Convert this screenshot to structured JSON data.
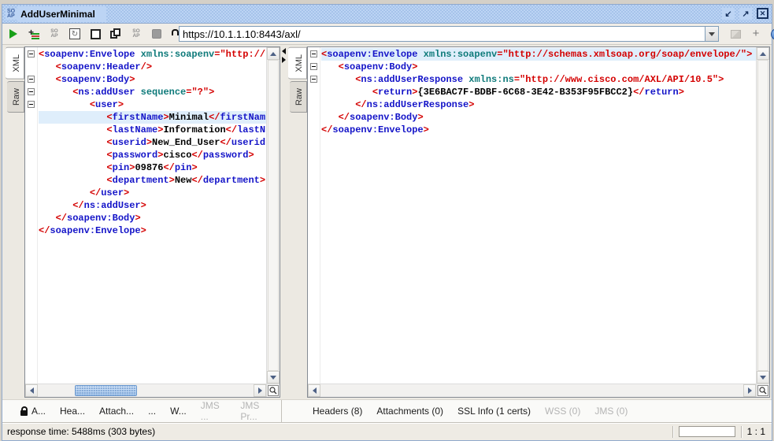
{
  "colors": {
    "tag": "#1414c8",
    "delim": "#d40000",
    "attr": "#0e7a7a",
    "value": "#d40000",
    "text": "#000000",
    "line_highlight": "#dfeefb",
    "titlebar_base": "#bcd4f4",
    "titlebar_checker": "#a6c3ea"
  },
  "window": {
    "title": "AddUserMinimal",
    "app_icon_top": "SO",
    "app_icon_bottom": "AP",
    "controls": [
      {
        "name": "minimize-button",
        "glyph": "↙",
        "boxed": false
      },
      {
        "name": "maximize-button",
        "glyph": "↗",
        "boxed": false
      },
      {
        "name": "close-button",
        "glyph": "✕",
        "boxed": true
      }
    ]
  },
  "toolbar": {
    "buttons": [
      {
        "name": "submit-request-button",
        "icon": "play",
        "disabled": false
      },
      {
        "name": "add-to-testcase-button",
        "icon": "addlines",
        "disabled": false
      },
      {
        "name": "add-to-mockservice-button",
        "icon": "soap",
        "disabled": false
      },
      {
        "name": "recreate-request-button",
        "icon": "recreate",
        "disabled": false
      },
      {
        "name": "create-empty-request-button",
        "icon": "empty",
        "disabled": false
      },
      {
        "name": "clone-request-button",
        "icon": "copy",
        "disabled": false
      },
      {
        "name": "create-soap-fault-button",
        "icon": "soap",
        "disabled": false
      },
      {
        "name": "cancel-request-button",
        "icon": "stop",
        "disabled": true
      }
    ],
    "soap_icon_top": "SO",
    "soap_icon_bottom": "AP",
    "endpoint_value": "https://10.1.1.10:8443/axl/",
    "right_buttons": [
      {
        "name": "tab-layout-button",
        "icon": "layout",
        "disabled": true
      },
      {
        "name": "add-endpoint-button",
        "icon": "plus",
        "disabled": false
      },
      {
        "name": "help-button",
        "icon": "help",
        "disabled": false
      }
    ],
    "plus_glyph": "+",
    "help_glyph": "?",
    "recreate_glyph": "↻"
  },
  "request_editor": {
    "side_tabs": [
      {
        "label": "XML",
        "selected": true
      },
      {
        "label": "Raw",
        "selected": false
      }
    ],
    "highlight_index": 5,
    "h_thumb": [
      17,
      29
    ],
    "lines": [
      {
        "fold": true,
        "segs": [
          [
            "d",
            "<"
          ],
          [
            "t",
            "soapenv:Envelope"
          ],
          [
            "x",
            " "
          ],
          [
            "a",
            "xmlns:soapenv"
          ],
          [
            "v",
            "=\"http://"
          ]
        ]
      },
      {
        "fold": false,
        "segs": [
          [
            "x",
            "   "
          ],
          [
            "d",
            "<"
          ],
          [
            "t",
            "soapenv:Header"
          ],
          [
            "d",
            "/>"
          ]
        ]
      },
      {
        "fold": true,
        "segs": [
          [
            "x",
            "   "
          ],
          [
            "d",
            "<"
          ],
          [
            "t",
            "soapenv:Body"
          ],
          [
            "d",
            ">"
          ]
        ]
      },
      {
        "fold": true,
        "segs": [
          [
            "x",
            "      "
          ],
          [
            "d",
            "<"
          ],
          [
            "t",
            "ns:addUser"
          ],
          [
            "x",
            " "
          ],
          [
            "a",
            "sequence"
          ],
          [
            "v",
            "=\"?\""
          ],
          [
            "d",
            ">"
          ]
        ]
      },
      {
        "fold": true,
        "segs": [
          [
            "x",
            "         "
          ],
          [
            "d",
            "<"
          ],
          [
            "t",
            "user"
          ],
          [
            "d",
            ">"
          ]
        ]
      },
      {
        "fold": false,
        "segs": [
          [
            "x",
            "            "
          ],
          [
            "d",
            "<"
          ],
          [
            "t",
            "firstName"
          ],
          [
            "d",
            ">"
          ],
          [
            "x",
            "Minimal"
          ],
          [
            "d",
            "</"
          ],
          [
            "t",
            "firstNam"
          ]
        ]
      },
      {
        "fold": false,
        "segs": [
          [
            "x",
            "            "
          ],
          [
            "d",
            "<"
          ],
          [
            "t",
            "lastName"
          ],
          [
            "d",
            ">"
          ],
          [
            "x",
            "Information"
          ],
          [
            "d",
            "</"
          ],
          [
            "t",
            "lastN"
          ]
        ]
      },
      {
        "fold": false,
        "segs": [
          [
            "x",
            "            "
          ],
          [
            "d",
            "<"
          ],
          [
            "t",
            "userid"
          ],
          [
            "d",
            ">"
          ],
          [
            "x",
            "New_End_User"
          ],
          [
            "d",
            "</"
          ],
          [
            "t",
            "userid"
          ]
        ]
      },
      {
        "fold": false,
        "segs": [
          [
            "x",
            "            "
          ],
          [
            "d",
            "<"
          ],
          [
            "t",
            "password"
          ],
          [
            "d",
            ">"
          ],
          [
            "x",
            "cisco"
          ],
          [
            "d",
            "</"
          ],
          [
            "t",
            "password"
          ],
          [
            "d",
            ">"
          ]
        ]
      },
      {
        "fold": false,
        "segs": [
          [
            "x",
            "            "
          ],
          [
            "d",
            "<"
          ],
          [
            "t",
            "pin"
          ],
          [
            "d",
            ">"
          ],
          [
            "x",
            "09876"
          ],
          [
            "d",
            "</"
          ],
          [
            "t",
            "pin"
          ],
          [
            "d",
            ">"
          ]
        ]
      },
      {
        "fold": false,
        "segs": [
          [
            "x",
            "            "
          ],
          [
            "d",
            "<"
          ],
          [
            "t",
            "department"
          ],
          [
            "d",
            ">"
          ],
          [
            "x",
            "New"
          ],
          [
            "d",
            "</"
          ],
          [
            "t",
            "department"
          ],
          [
            "d",
            ">"
          ]
        ]
      },
      {
        "fold": false,
        "segs": [
          [
            "x",
            "         "
          ],
          [
            "d",
            "</"
          ],
          [
            "t",
            "user"
          ],
          [
            "d",
            ">"
          ]
        ]
      },
      {
        "fold": false,
        "segs": [
          [
            "x",
            "      "
          ],
          [
            "d",
            "</"
          ],
          [
            "t",
            "ns:addUser"
          ],
          [
            "d",
            ">"
          ]
        ]
      },
      {
        "fold": false,
        "segs": [
          [
            "x",
            "   "
          ],
          [
            "d",
            "</"
          ],
          [
            "t",
            "soapenv:Body"
          ],
          [
            "d",
            ">"
          ]
        ]
      },
      {
        "fold": false,
        "segs": [
          [
            "d",
            "</"
          ],
          [
            "t",
            "soapenv:Envelope"
          ],
          [
            "d",
            ">"
          ]
        ]
      }
    ]
  },
  "response_editor": {
    "side_tabs": [
      {
        "label": "XML",
        "selected": true
      },
      {
        "label": "Raw",
        "selected": false
      }
    ],
    "highlight_index": 0,
    "h_thumb": null,
    "lines": [
      {
        "fold": true,
        "segs": [
          [
            "d",
            "<"
          ],
          [
            "t",
            "soapenv:Envelope"
          ],
          [
            "x",
            " "
          ],
          [
            "a",
            "xmlns:soapenv"
          ],
          [
            "v",
            "=\"http://schemas.xmlsoap.org/soap/envelope/\""
          ],
          [
            "d",
            ">"
          ]
        ]
      },
      {
        "fold": true,
        "segs": [
          [
            "x",
            "   "
          ],
          [
            "d",
            "<"
          ],
          [
            "t",
            "soapenv:Body"
          ],
          [
            "d",
            ">"
          ]
        ]
      },
      {
        "fold": true,
        "segs": [
          [
            "x",
            "      "
          ],
          [
            "d",
            "<"
          ],
          [
            "t",
            "ns:addUserResponse"
          ],
          [
            "x",
            " "
          ],
          [
            "a",
            "xmlns:ns"
          ],
          [
            "v",
            "=\"http://www.cisco.com/AXL/API/10.5\""
          ],
          [
            "d",
            ">"
          ]
        ]
      },
      {
        "fold": false,
        "segs": [
          [
            "x",
            "         "
          ],
          [
            "d",
            "<"
          ],
          [
            "t",
            "return"
          ],
          [
            "d",
            ">"
          ],
          [
            "x",
            "{3E6BAC7F-BDBF-6C68-3E42-B353F95FBCC2}"
          ],
          [
            "d",
            "</"
          ],
          [
            "t",
            "return"
          ],
          [
            "d",
            ">"
          ]
        ]
      },
      {
        "fold": false,
        "segs": [
          [
            "x",
            "      "
          ],
          [
            "d",
            "</"
          ],
          [
            "t",
            "ns:addUserResponse"
          ],
          [
            "d",
            ">"
          ]
        ]
      },
      {
        "fold": false,
        "segs": [
          [
            "x",
            "   "
          ],
          [
            "d",
            "</"
          ],
          [
            "t",
            "soapenv:Body"
          ],
          [
            "d",
            ">"
          ]
        ]
      },
      {
        "fold": false,
        "segs": [
          [
            "d",
            "</"
          ],
          [
            "t",
            "soapenv:Envelope"
          ],
          [
            "d",
            ">"
          ]
        ]
      }
    ]
  },
  "request_tabs": [
    {
      "label": "A...",
      "lock": true,
      "disabled": false
    },
    {
      "label": "Hea...",
      "lock": false,
      "disabled": false
    },
    {
      "label": "Attach...",
      "lock": false,
      "disabled": false
    },
    {
      "label": "...",
      "lock": false,
      "disabled": false
    },
    {
      "label": "W...",
      "lock": false,
      "disabled": false
    },
    {
      "label": "JMS ...",
      "lock": false,
      "disabled": true
    },
    {
      "label": "JMS Pr...",
      "lock": false,
      "disabled": true
    }
  ],
  "response_tabs": [
    {
      "label": "Headers (8)",
      "disabled": false
    },
    {
      "label": "Attachments (0)",
      "disabled": false
    },
    {
      "label": "SSL Info (1 certs)",
      "disabled": false
    },
    {
      "label": "WSS (0)",
      "disabled": true
    },
    {
      "label": "JMS (0)",
      "disabled": true
    }
  ],
  "status_bar": {
    "message": "response time: 5488ms (303 bytes)",
    "caret_position": "1 : 1"
  }
}
